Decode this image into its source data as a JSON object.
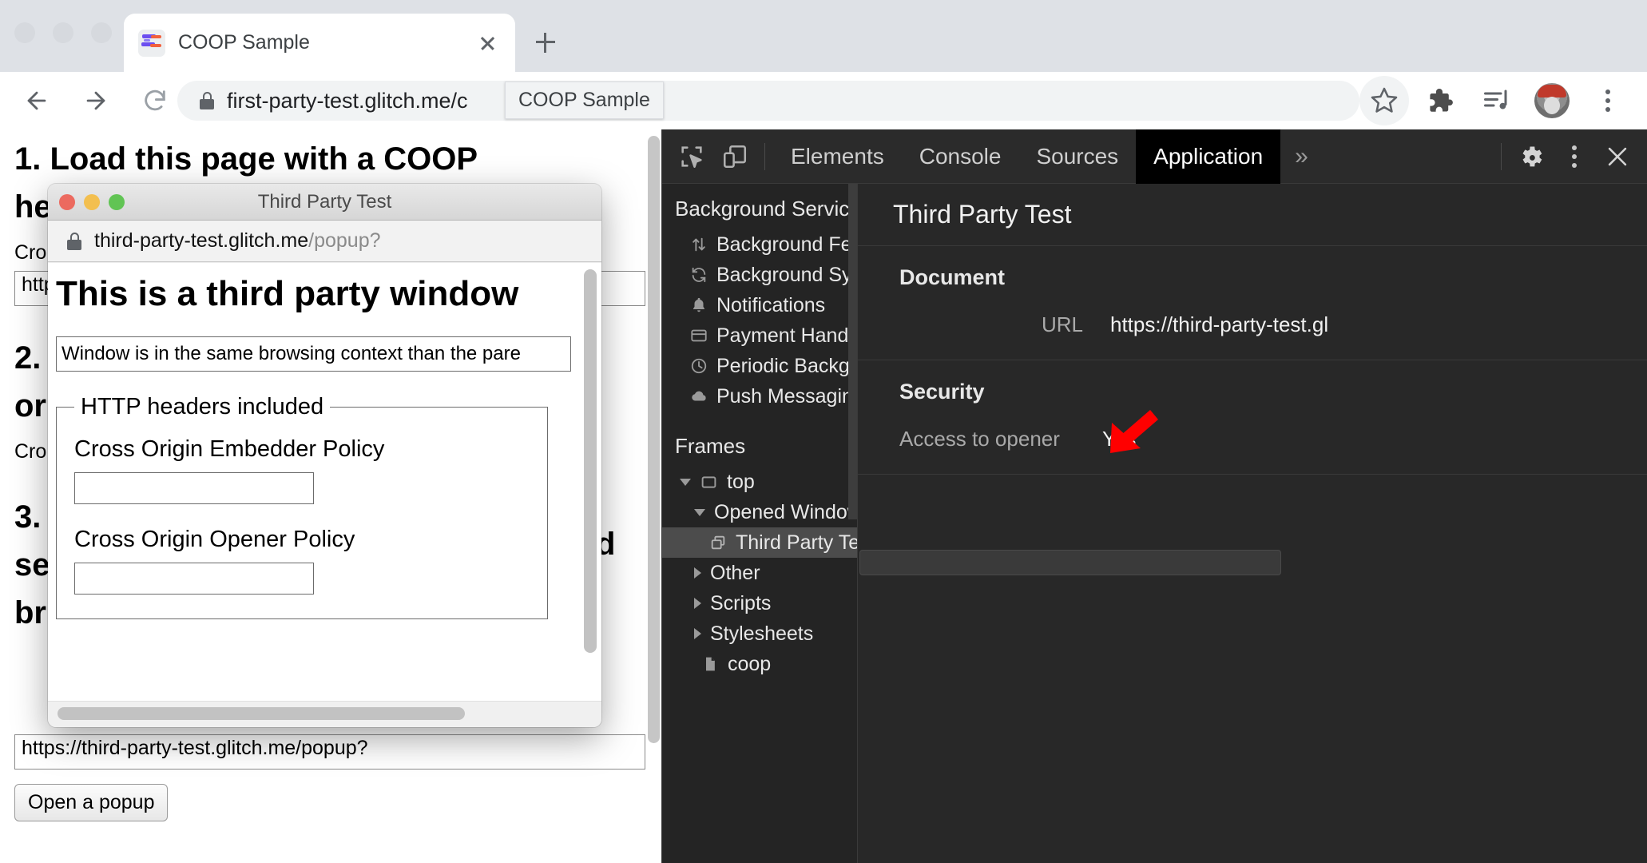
{
  "browser": {
    "tab": {
      "title": "COOP Sample",
      "favicon_name": "glitch-fish-favicon"
    },
    "new_tab_label": "+",
    "omnibox": {
      "url_main": "first-party-test.glitch.me/c",
      "url_dim": ""
    },
    "tooltip": "COOP Sample",
    "toolbar_icons": [
      "star-icon",
      "extensions-puzzle-icon",
      "media-control-icon",
      "avatar-icon",
      "chrome-menu-icon"
    ]
  },
  "page": {
    "heading1": "1. Load this page with a COOP",
    "heading1b": "he",
    "para1": "Cro",
    "input1_value": "http",
    "heading2a": "2.",
    "heading2b": "or",
    "para2": "Cro",
    "heading3a": "3.",
    "heading3b": "se",
    "heading3c": "br",
    "right_letter": "d",
    "url_input_value": "https://third-party-test.glitch.me/popup?",
    "open_popup_button": "Open a popup"
  },
  "popup": {
    "title": "Third Party Test",
    "url_main": "third-party-test.glitch.me",
    "url_dim": "/popup?",
    "heading": "This is a third party window",
    "status_text": "Window is in the same browsing context than the pare",
    "fieldset_legend": "HTTP headers included",
    "coep_label": "Cross Origin Embedder Policy",
    "coep_value": "",
    "coop_label": "Cross Origin Opener Policy",
    "coop_value": ""
  },
  "devtools": {
    "tabs": [
      {
        "label": "Elements",
        "active": false
      },
      {
        "label": "Console",
        "active": false
      },
      {
        "label": "Sources",
        "active": false
      },
      {
        "label": "Application",
        "active": true
      }
    ],
    "more_label": "»",
    "sidebar": {
      "background_services_title": "Background Services",
      "background_services": [
        {
          "label": "Background Fetch",
          "icon": "fetch-arrows-icon"
        },
        {
          "label": "Background Sync",
          "icon": "sync-icon"
        },
        {
          "label": "Notifications",
          "icon": "bell-icon"
        },
        {
          "label": "Payment Handler",
          "icon": "credit-card-icon"
        },
        {
          "label": "Periodic Background Sync",
          "icon": "clock-icon"
        },
        {
          "label": "Push Messaging",
          "icon": "cloud-icon"
        }
      ],
      "frames_title": "Frames",
      "frames": [
        {
          "label": "top",
          "icon": "frame-icon",
          "selected": false
        },
        {
          "label": "Opened Windows",
          "icon": "",
          "selected": false
        },
        {
          "label": "Third Party Test",
          "icon": "window-icon",
          "selected": true
        },
        {
          "label": "Other",
          "icon": "",
          "selected": false
        },
        {
          "label": "Scripts",
          "icon": "",
          "selected": false
        },
        {
          "label": "Stylesheets",
          "icon": "",
          "selected": false
        },
        {
          "label": "coop",
          "icon": "document-icon",
          "selected": false
        }
      ]
    },
    "main": {
      "header": "Third Party Test",
      "document_group": "Document",
      "url_key": "URL",
      "url_value": "https://third-party-test.gl",
      "security_group": "Security",
      "access_key": "Access to opener",
      "access_value": "Yes"
    },
    "annotation": {
      "name": "red-arrow-annotation",
      "color": "#ff0000"
    }
  }
}
